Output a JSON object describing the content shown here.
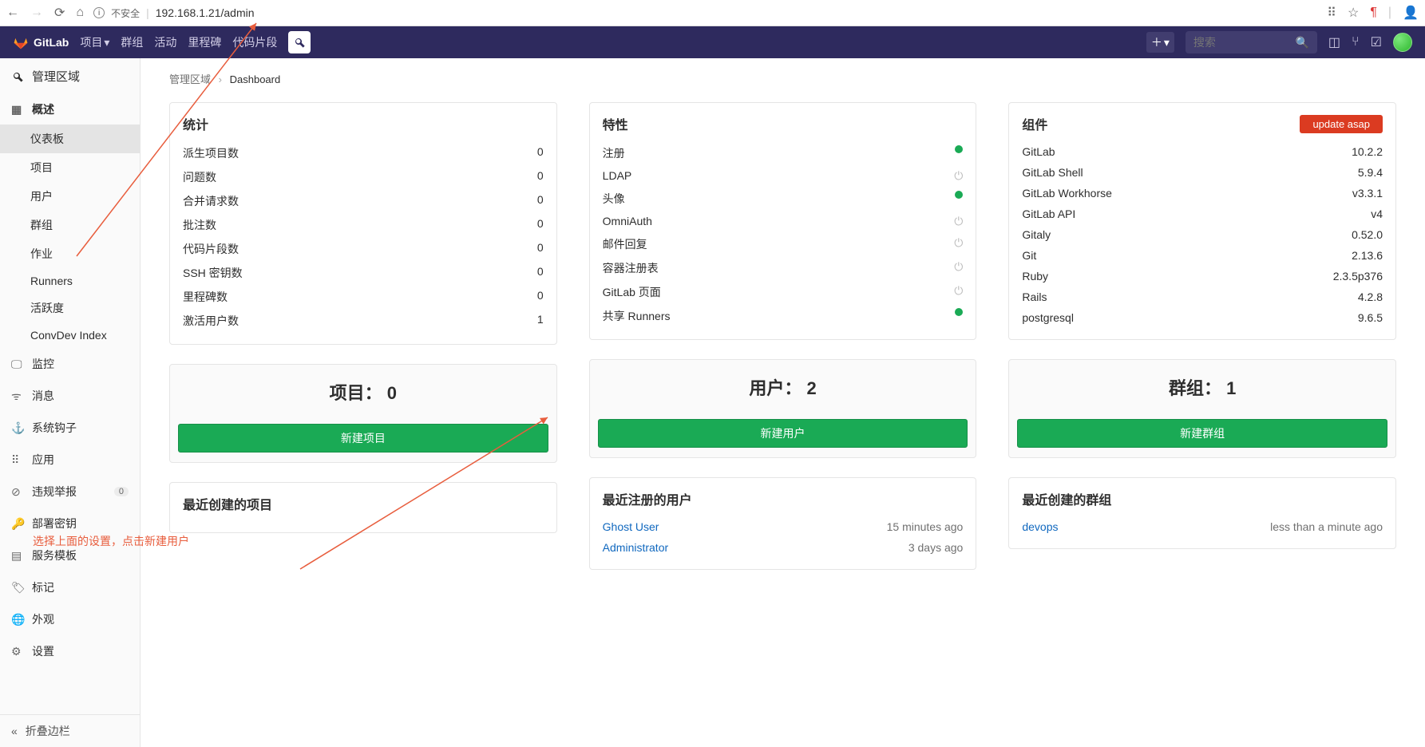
{
  "browser": {
    "insecure_label": "不安全",
    "url": "192.168.1.21/admin"
  },
  "topnav": {
    "brand": "GitLab",
    "items": [
      "项目",
      "群组",
      "活动",
      "里程碑",
      "代码片段"
    ],
    "search_placeholder": "搜索"
  },
  "sidebar": {
    "header": "管理区域",
    "overview": {
      "label": "概述",
      "items": [
        "仪表板",
        "项目",
        "用户",
        "群组",
        "作业",
        "Runners",
        "活跃度",
        "ConvDev Index"
      ]
    },
    "sections": [
      {
        "label": "监控"
      },
      {
        "label": "消息"
      },
      {
        "label": "系统钩子"
      },
      {
        "label": "应用"
      },
      {
        "label": "违规举报",
        "badge": "0"
      },
      {
        "label": "部署密钥"
      },
      {
        "label": "服务模板"
      },
      {
        "label": "标记"
      },
      {
        "label": "外观"
      },
      {
        "label": "设置"
      }
    ],
    "collapse": "折叠边栏"
  },
  "breadcrumb": {
    "root": "管理区域",
    "current": "Dashboard"
  },
  "stats": {
    "title": "统计",
    "rows": [
      {
        "label": "派生项目数",
        "value": "0"
      },
      {
        "label": "问题数",
        "value": "0"
      },
      {
        "label": "合并请求数",
        "value": "0"
      },
      {
        "label": "批注数",
        "value": "0"
      },
      {
        "label": "代码片段数",
        "value": "0"
      },
      {
        "label": "SSH 密钥数",
        "value": "0"
      },
      {
        "label": "里程碑数",
        "value": "0"
      },
      {
        "label": "激活用户数",
        "value": "1"
      }
    ]
  },
  "features": {
    "title": "特性",
    "rows": [
      {
        "label": "注册",
        "on": true
      },
      {
        "label": "LDAP",
        "on": false
      },
      {
        "label": "头像",
        "on": true
      },
      {
        "label": "OmniAuth",
        "on": false
      },
      {
        "label": "邮件回复",
        "on": false
      },
      {
        "label": "容器注册表",
        "on": false
      },
      {
        "label": "GitLab 页面",
        "on": false
      },
      {
        "label": "共享 Runners",
        "on": true
      }
    ]
  },
  "components": {
    "title": "组件",
    "update_label": "update asap",
    "rows": [
      {
        "label": "GitLab",
        "value": "10.2.2"
      },
      {
        "label": "GitLab Shell",
        "value": "5.9.4"
      },
      {
        "label": "GitLab Workhorse",
        "value": "v3.3.1"
      },
      {
        "label": "GitLab API",
        "value": "v4"
      },
      {
        "label": "Gitaly",
        "value": "0.52.0"
      },
      {
        "label": "Git",
        "value": "2.13.6"
      },
      {
        "label": "Ruby",
        "value": "2.3.5p376"
      },
      {
        "label": "Rails",
        "value": "4.2.8"
      },
      {
        "label": "postgresql",
        "value": "9.6.5"
      }
    ]
  },
  "summaries": {
    "projects": {
      "label": "项目：",
      "count": "0",
      "button": "新建项目"
    },
    "users": {
      "label": "用户：",
      "count": "2",
      "button": "新建用户"
    },
    "groups": {
      "label": "群组：",
      "count": "1",
      "button": "新建群组"
    }
  },
  "recent": {
    "projects": {
      "title": "最近创建的项目"
    },
    "users": {
      "title": "最近注册的用户",
      "rows": [
        {
          "name": "Ghost User",
          "time": "15 minutes ago"
        },
        {
          "name": "Administrator",
          "time": "3 days ago"
        }
      ]
    },
    "groups": {
      "title": "最近创建的群组",
      "rows": [
        {
          "name": "devops",
          "time": "less than a minute ago"
        }
      ]
    }
  },
  "annotation": "选择上面的设置，点击新建用户"
}
